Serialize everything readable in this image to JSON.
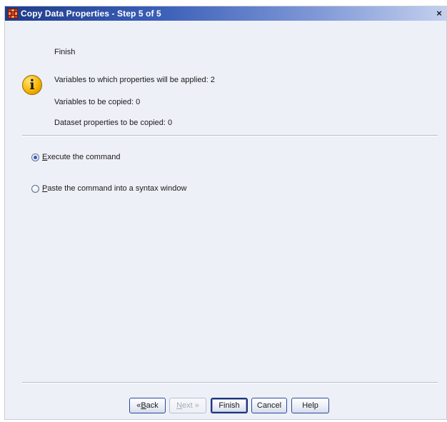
{
  "window": {
    "title": "Copy Data Properties - Step 5 of 5",
    "close_glyph": "×"
  },
  "summary": {
    "heading": "Finish",
    "icon": "info-icon",
    "icon_glyph": "i",
    "lines": [
      "Variables to which properties will be applied: 2",
      "Variables to be copied: 0",
      "Dataset properties to be copied: 0"
    ]
  },
  "options": {
    "selected": "execute",
    "execute": {
      "mnemonic": "E",
      "rest": "xecute the command"
    },
    "paste": {
      "mnemonic": "P",
      "rest": "aste the command into a syntax window"
    }
  },
  "buttons": {
    "back": {
      "prefix": "« ",
      "mnemonic": "B",
      "rest": "ack"
    },
    "next": {
      "mnemonic": "N",
      "rest": "ext »"
    },
    "finish": "Finish",
    "cancel": "Cancel",
    "help": "Help"
  },
  "colors": {
    "title_bar_start": "#1f3c8a",
    "dialog_background": "#eef0f7",
    "button_border": "#2a4a9a",
    "radio_dot": "#2a5bc7"
  }
}
